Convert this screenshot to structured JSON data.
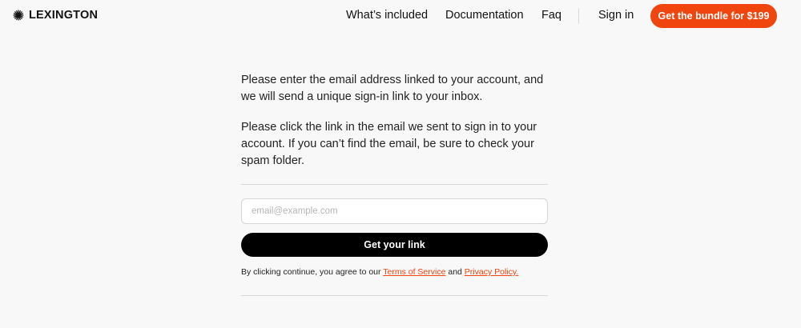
{
  "header": {
    "logo_text": "LEXINGTON",
    "logo_icon": "starburst-icon",
    "nav": {
      "whats_included": "What’s included",
      "documentation": "Documentation",
      "faq": "Faq",
      "sign_in": "Sign in"
    },
    "cta_label": "Get the bundle for $199"
  },
  "main": {
    "intro_paragraph": "Please enter the email address linked to your account, and we will send a unique sign-in link to your inbox.",
    "instructions_paragraph": "Please click the link in the email we sent to sign in to your account. If you can’t find the email, be sure to check your spam folder.",
    "email_placeholder": "email@example.com",
    "email_value": "",
    "submit_label": "Get your link",
    "legal": {
      "prefix": "By clicking continue, you agree to our ",
      "terms_label": "Terms of Service",
      "joiner": " and ",
      "privacy_label": "Privacy Policy."
    }
  },
  "colors": {
    "accent": "#f0450f",
    "background": "#f8f8f8",
    "button_dark": "#000000"
  }
}
